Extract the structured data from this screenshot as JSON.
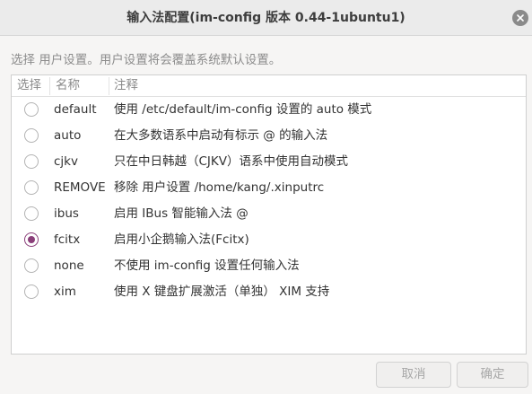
{
  "window": {
    "title": "输入法配置(im-config 版本 0.44-1ubuntu1)"
  },
  "instruction": "选择 用户设置。用户设置将会覆盖系统默认设置。",
  "table": {
    "headers": {
      "select": "选择",
      "name": "名称",
      "note": "注释"
    },
    "rows": [
      {
        "name": "default",
        "desc": "使用 /etc/default/im-config 设置的 auto 模式",
        "selected": false
      },
      {
        "name": "auto",
        "desc": "在大多数语系中启动有标示 @ 的输入法",
        "selected": false
      },
      {
        "name": "cjkv",
        "desc": "只在中日韩越（CJKV）语系中使用自动模式",
        "selected": false
      },
      {
        "name": "REMOVE",
        "desc": "移除 用户设置 /home/kang/.xinputrc",
        "selected": false
      },
      {
        "name": "ibus",
        "desc": "启用 IBus 智能输入法 @",
        "selected": false
      },
      {
        "name": "fcitx",
        "desc": "启用小企鹅输入法(Fcitx)",
        "selected": true
      },
      {
        "name": "none",
        "desc": "不使用 im-config 设置任何输入法",
        "selected": false
      },
      {
        "name": "xim",
        "desc": "使用 X 键盘扩展激活（单独） XIM 支持",
        "selected": false
      }
    ]
  },
  "buttons": {
    "cancel": "取消",
    "ok": "确定"
  },
  "colors": {
    "accent": "#8a3e79",
    "titlebar": "#ebebeb",
    "background": "#f6f5f4"
  },
  "icons": {
    "close": "close-icon"
  }
}
